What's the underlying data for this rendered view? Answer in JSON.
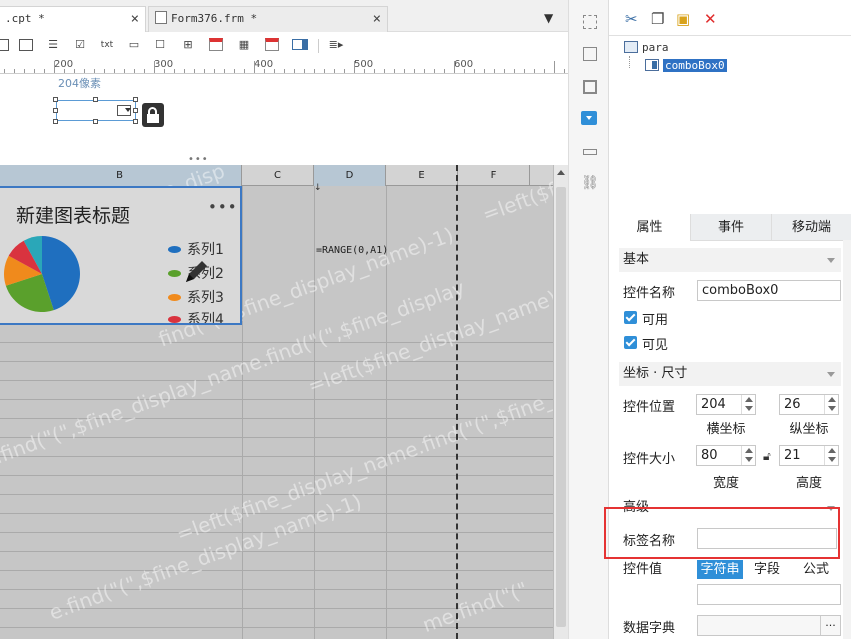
{
  "tabs": [
    {
      "label": ".cpt *",
      "close": "×"
    },
    {
      "label": "Form376.frm *",
      "close": "×"
    }
  ],
  "ruler": {
    "labels": [
      "200",
      "300",
      "400",
      "500",
      "600"
    ]
  },
  "form": {
    "position_label": "204像素"
  },
  "grid": {
    "columns": [
      "B",
      "C",
      "D",
      "E",
      "F"
    ],
    "formula": "=RANGE(0,A1)",
    "arrow_mark": "↓"
  },
  "chart_widget": {
    "title": "新建图表标题",
    "more": "•••",
    "legend": [
      "系列1",
      "系列2",
      "系列3",
      "系列4"
    ],
    "colors": [
      "#1f6fbf",
      "#5aa02c",
      "#f08a1c",
      "#d9333f",
      "#2aa7b8"
    ]
  },
  "watermark": {
    "texts": [
      "=left($fine_disp",
      "=left($fine",
      "find(\"(\",$fine_display_name)-1)",
      ".find(\"(\",$fine_display_name.find(\"(\",$fine_display",
      "=left($fine_display_name.find(\"(\",$fine_display_name)-1)",
      "=left($fine_display_name)-1)",
      "e.find(\"(\",$fine_display_name)-1)",
      "me.find(\"(\""
    ]
  },
  "tree": {
    "root": "para",
    "child": "comboBox0"
  },
  "panel_tabs": [
    "属性",
    "事件",
    "移动端"
  ],
  "props": {
    "basic_section": "基本",
    "widget_name_label": "控件名称",
    "widget_name_value": "comboBox0",
    "enabled_label": "可用",
    "visible_label": "可见",
    "coord_section": "坐标 · 尺寸",
    "position_label": "控件位置",
    "pos_x": "204",
    "pos_y": "26",
    "x_label": "横坐标",
    "y_label": "纵坐标",
    "size_label": "控件大小",
    "width": "80",
    "height": "21",
    "width_label": "宽度",
    "height_label": "高度",
    "advanced_section": "高级",
    "tag_name_label": "标签名称",
    "tag_name_value": "",
    "widget_value_label": "控件值",
    "value_modes": [
      "字符串",
      "字段",
      "公式"
    ],
    "data_dict_label": "数据字典",
    "dict_btn": "···"
  }
}
